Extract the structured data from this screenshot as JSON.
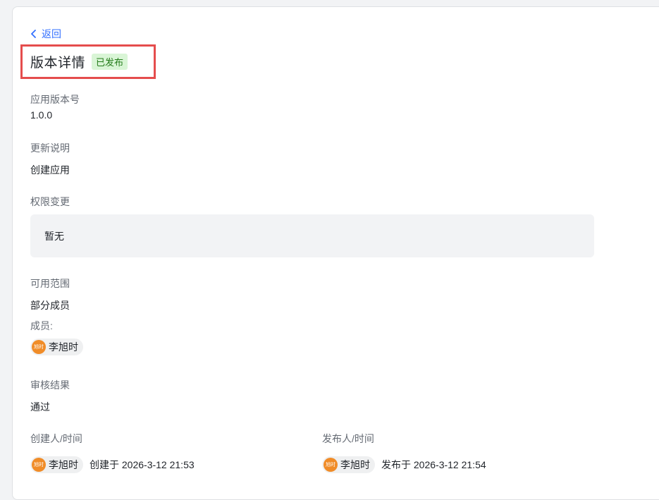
{
  "back": {
    "label": "返回"
  },
  "header": {
    "title": "版本详情",
    "status_badge": "已发布"
  },
  "app_version": {
    "label": "应用版本号",
    "value": "1.0.0"
  },
  "update_notes": {
    "label": "更新说明",
    "value": "创建应用"
  },
  "permission_changes": {
    "label": "权限变更",
    "value": "暂无"
  },
  "availability": {
    "label": "可用范围",
    "value": "部分成员",
    "members_label": "成员:",
    "members": [
      {
        "name": "李旭时",
        "avatar_text": "旭时"
      }
    ]
  },
  "review": {
    "label": "审核结果",
    "value": "通过"
  },
  "creator": {
    "label": "创建人/时间",
    "name": "李旭时",
    "avatar_text": "旭时",
    "time_text": "创建于 2026-3-12 21:53"
  },
  "publisher": {
    "label": "发布人/时间",
    "name": "李旭时",
    "avatar_text": "旭时",
    "time_text": "发布于 2026-3-12 21:54"
  },
  "colors": {
    "accent": "#3370ff",
    "badge_bg": "#d9f5d6",
    "badge_text": "#237b19",
    "highlight_border": "#e54d4d",
    "avatar_bg": "#f08c28"
  }
}
